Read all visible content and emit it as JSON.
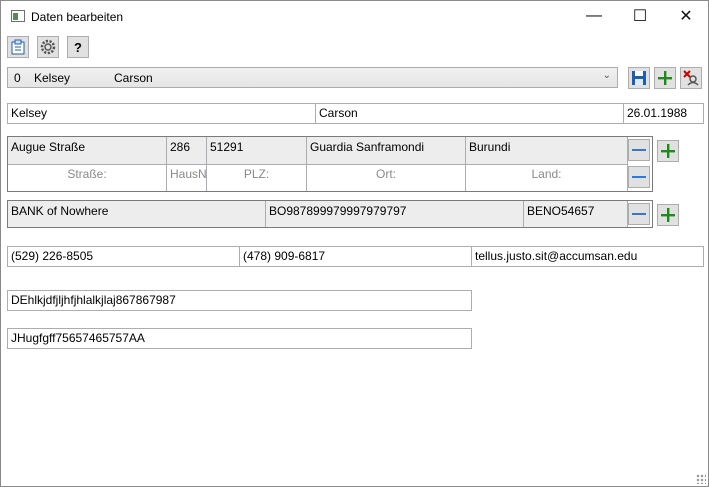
{
  "window": {
    "title": "Daten bearbeiten",
    "controls": {
      "minimize": "—",
      "maximize": "☐",
      "close": "✕"
    }
  },
  "toolbar": {
    "help_label": "?"
  },
  "selector": {
    "id": "0",
    "first": "Kelsey",
    "last": "Carson"
  },
  "person": {
    "first_name": "Kelsey",
    "last_name": "Carson",
    "birth_date": "26.01.1988"
  },
  "address": {
    "street": "Augue Straße",
    "house_no": "286",
    "zip": "51291",
    "city": "Guardia Sanframondi",
    "country": "Burundi",
    "placeholders": {
      "street": "Straße:",
      "house_no": "HausN",
      "zip": "PLZ:",
      "city": "Ort:",
      "country": "Land:"
    }
  },
  "bank": {
    "name": "BANK of Nowhere",
    "iban": "BO987899979997979797",
    "bic": "BENO54657"
  },
  "contact": {
    "phone1": "(529) 226-8505",
    "phone2": "(478) 909-6817",
    "email": "tellus.justo.sit@accumsan.edu"
  },
  "extra": {
    "field1": "DEhlkjdfjljhfjhlalkjlaj867867987",
    "field2": "JHugfgff75657465757AA"
  },
  "colors": {
    "accent_blue": "#1f5fb0",
    "plus_green": "#1e8a1e",
    "minus_blue": "#2f7bd3"
  }
}
